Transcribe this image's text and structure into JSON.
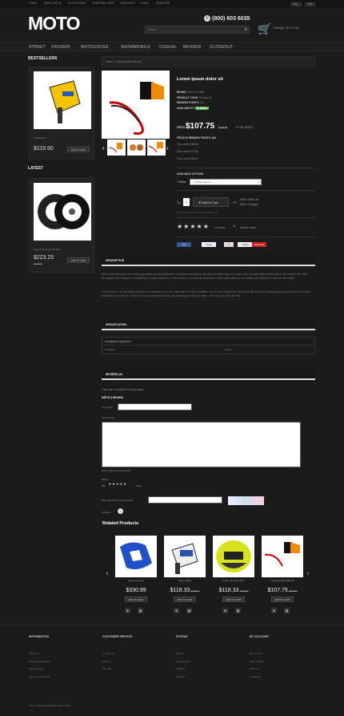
{
  "topbar": {
    "links": [
      "HOME",
      "WISH LIST (0)",
      "MY ACCOUNT",
      "SHOPPING CART",
      "CHECKOUT",
      "LOGIN",
      "REGISTER"
    ],
    "lang": "Eng",
    "currency": "USD"
  },
  "header": {
    "logo": "MOTO",
    "phone": "(800) 603 6035",
    "search_placeholder": "Search",
    "cart": "1 item(s) - $1,177.00"
  },
  "nav": [
    "STREET",
    "CRUISER",
    "MOTOCROSS",
    "SNOWMOBILE",
    "CASUAL",
    "BRANDS",
    "CLOSEOUT"
  ],
  "sidebar": {
    "bestsellers_title": "BESTSELLERS",
    "best_name": "Ut labore et",
    "best_price": "$119.50",
    "latest_title": "LATEST",
    "latest_name": "Magna sed dolor sit amet",
    "latest_price": "$223.25",
    "latest_old": "$235.00",
    "add_label": "ADD TO CART"
  },
  "breadcrumb": "Home › Lorem ipsum dolor sit",
  "product": {
    "title": "Lorem ipsum dolor sit",
    "brand_l": "BRAND:",
    "brand": "Dolore Ut aliqt",
    "code_l": "PRODUCT CODE:",
    "code": "Product 15",
    "reward_l": "REWARD POINTS:",
    "reward": "100",
    "avail_l": "AVAILABILITY:",
    "avail": "In Stock",
    "price_l": "PRICE:",
    "price": "$107.75",
    "old": "$119.50",
    "extax": "Ex Tax: $90.00",
    "points": "PRICE IN REWARD POINTS: 400",
    "disc1": "10 or more $ 80.00",
    "disc2": "20 or more $ 70.00",
    "disc3": "30 or more $ 60.00",
    "options_l": "AVAILABLE OPTIONS",
    "select_l": "* Select:",
    "select_v": "--- Please Select ---",
    "qty_l": "Qty:",
    "qty": "1",
    "add": "Add to Cart",
    "or": "- OR -",
    "wish": "Add to Wish List",
    "compare": "Add to Compare",
    "minimum": "This product has a minimum quantity of 2",
    "reviews": "0 reviews",
    "write": "Write a review",
    "share": [
      "Like",
      "Tweet",
      "+1",
      "Share",
      "Pinterest"
    ]
  },
  "tabs": {
    "desc": "DESCRIPTION",
    "spec": "SPECIFICATION",
    "reviews": "REVIEWS (0)"
  },
  "description": {
    "p1": "Here at the Motorcycle Store we've guaranteed a full satisfaction of any customer that comes with our online shop. It is hard to find another reliable distributor on the market, that offers this quality of motorcycles. Considering our huge experience in the industry of motorcycle distribution, motorcycle racing we can assure you that there is best on the market.",
    "p2": "The success of our company depends on customers, we've put huge effort to make it possible. Our 20 years experience combined with the most professional staff guarantee you find the motorcycle that suits you. Make your choice today and enjoy your amazing ride with our store - we'll help you along the way."
  },
  "spec": {
    "group": "ATTRIBUTE GROUPS 3",
    "attr": "Attribute 1",
    "val": "0 items"
  },
  "reviews": {
    "none": "There are no reviews for this product.",
    "write": "WRITE A REVIEW",
    "name_l": "Your Name:",
    "review_l": "Your Review:",
    "note": "Note: HTML is not translated!",
    "rating_l": "Rating:",
    "bad": "Bad",
    "good": "Good",
    "captcha_l": "Enter the code in the box below:",
    "continue": "Continue"
  },
  "related": {
    "title": "Related Products",
    "items": [
      {
        "name": "Ipsum sit amet",
        "price": "$330.99",
        "old": ""
      },
      {
        "name": "Ipsum dolor",
        "price": "$118.33",
        "old": "$120.44"
      },
      {
        "name": "Ipsum sit amet dolor",
        "price": "$118.33",
        "old": "$120.44"
      },
      {
        "name": "Lorem ipsum dolor sit",
        "price": "$107.75",
        "old": "$119.50"
      }
    ],
    "add": "ADD TO CART"
  },
  "footer": {
    "cols": [
      {
        "title": "INFORMATION",
        "links": [
          "About Us",
          "Delivery Information",
          "Privacy Policy",
          "Terms & Conditions"
        ]
      },
      {
        "title": "CUSTOMER SERVICE",
        "links": [
          "Contact Us",
          "Returns",
          "Site Map"
        ]
      },
      {
        "title": "EXTRAS",
        "links": [
          "Brands",
          "Gift Vouchers",
          "Affiliates",
          "Specials"
        ]
      },
      {
        "title": "MY ACCOUNT",
        "links": [
          "My Account",
          "Order History",
          "Wish List",
          "Newsletter"
        ]
      }
    ],
    "copyright": "Powered By OpenCart Moto store © 2013"
  },
  "colors": {
    "accent": "#5cb85c",
    "bg": "#1b1b1b"
  }
}
